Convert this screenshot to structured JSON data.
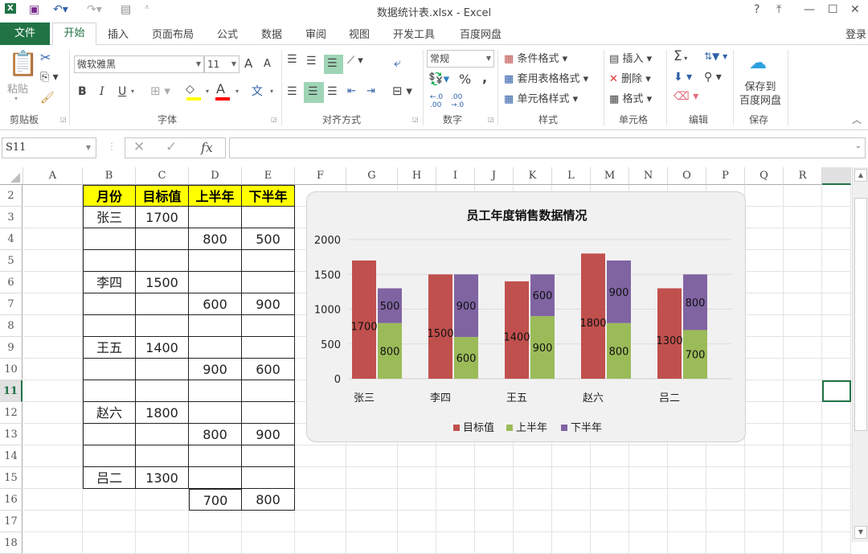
{
  "titlebar": {
    "title": "数据统计表.xlsx - Excel",
    "help": "?",
    "ribbon_display": "⤒",
    "minimize": "—",
    "maximize": "☐",
    "close": "✕"
  },
  "tabs": {
    "file": "文件",
    "items": [
      "开始",
      "插入",
      "页面布局",
      "公式",
      "数据",
      "审阅",
      "视图",
      "开发工具",
      "百度网盘"
    ],
    "signin": "登录"
  },
  "ribbon": {
    "clipboard": {
      "label": "剪贴板",
      "paste": "粘贴"
    },
    "font": {
      "label": "字体",
      "font_name": "微软雅黑",
      "font_size": "11",
      "bold": "B",
      "italic": "I",
      "underline": "U",
      "grow": "A",
      "shrink": "A",
      "fill_color": "#ffff00",
      "font_color": "#ff0000",
      "phonetic": "文"
    },
    "alignment": {
      "label": "对齐方式"
    },
    "number": {
      "label": "数字",
      "format": "常规",
      "percent": "%",
      "comma": ","
    },
    "styles": {
      "label": "样式",
      "conditional": "条件格式",
      "table": "套用表格格式",
      "cell_styles": "单元格样式"
    },
    "cells": {
      "label": "单元格",
      "insert": "插入",
      "delete": "删除",
      "format": "格式"
    },
    "editing": {
      "label": "编辑",
      "sum": "Σ"
    },
    "save": {
      "label": "保存",
      "btn_line1": "保存到",
      "btn_line2": "百度网盘"
    }
  },
  "formula_bar": {
    "name_box": "S11",
    "cancel": "✕",
    "enter": "✓",
    "fx": "fx",
    "value": ""
  },
  "columns": [
    "A",
    "B",
    "C",
    "D",
    "E",
    "F",
    "G",
    "H",
    "I",
    "J",
    "K",
    "L",
    "M",
    "N",
    "O",
    "P",
    "Q",
    "R",
    ""
  ],
  "rows": [
    "2",
    "3",
    "4",
    "5",
    "6",
    "7",
    "8",
    "9",
    "10",
    "11",
    "12",
    "13",
    "14",
    "15",
    "16",
    "17",
    "18"
  ],
  "table": {
    "headers": [
      "月份",
      "目标值",
      "上半年",
      "下半年"
    ],
    "cells": [
      {
        "row": 3,
        "col": "B",
        "v": "张三"
      },
      {
        "row": 3,
        "col": "C",
        "v": "1700"
      },
      {
        "row": 4,
        "col": "D",
        "v": "800"
      },
      {
        "row": 4,
        "col": "E",
        "v": "500"
      },
      {
        "row": 6,
        "col": "B",
        "v": "李四"
      },
      {
        "row": 6,
        "col": "C",
        "v": "1500"
      },
      {
        "row": 7,
        "col": "D",
        "v": "600"
      },
      {
        "row": 7,
        "col": "E",
        "v": "900"
      },
      {
        "row": 9,
        "col": "B",
        "v": "王五"
      },
      {
        "row": 9,
        "col": "C",
        "v": "1400"
      },
      {
        "row": 10,
        "col": "D",
        "v": "900"
      },
      {
        "row": 10,
        "col": "E",
        "v": "600"
      },
      {
        "row": 12,
        "col": "B",
        "v": "赵六"
      },
      {
        "row": 12,
        "col": "C",
        "v": "1800"
      },
      {
        "row": 13,
        "col": "D",
        "v": "800"
      },
      {
        "row": 13,
        "col": "E",
        "v": "900"
      },
      {
        "row": 15,
        "col": "B",
        "v": "吕二"
      },
      {
        "row": 15,
        "col": "C",
        "v": "1300"
      },
      {
        "row": 16,
        "col": "D",
        "v": "700"
      },
      {
        "row": 16,
        "col": "E",
        "v": "800"
      }
    ]
  },
  "chart_data": {
    "type": "bar",
    "title": "员工年度销售数据情况",
    "categories": [
      "张三",
      "李四",
      "王五",
      "赵六",
      "吕二"
    ],
    "series": [
      {
        "name": "目标值",
        "values": [
          1700,
          1500,
          1400,
          1800,
          1300
        ],
        "color": "#c0504d",
        "stack": "a"
      },
      {
        "name": "上半年",
        "values": [
          800,
          600,
          900,
          800,
          700
        ],
        "color": "#9bbb59",
        "stack": "b"
      },
      {
        "name": "下半年",
        "values": [
          500,
          900,
          600,
          900,
          800
        ],
        "color": "#8064a2",
        "stack": "b"
      }
    ],
    "yticks": [
      "0",
      "500",
      "1000",
      "1500",
      "2000"
    ],
    "ylim": [
      0,
      2000
    ],
    "grid": true,
    "legend": "bottom",
    "xlabel": "",
    "ylabel": ""
  }
}
